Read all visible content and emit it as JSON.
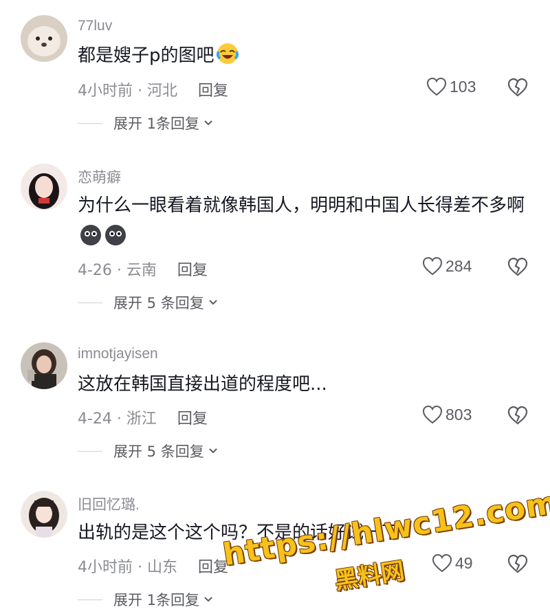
{
  "comments": [
    {
      "username": "77luv",
      "text": "都是嫂子p的图吧",
      "emojis": [
        "laughing-crying-emoji"
      ],
      "time": "4小时前",
      "location": "河北",
      "meta": "4小时前 · 河北",
      "reply_label": "回复",
      "likes": "103",
      "expand_label": "展开 1条回复"
    },
    {
      "username": "恋萌癖",
      "text": "为什么一眼看着就像韩国人，明明和中国人长得差不多啊",
      "emojis": [
        "dark-face-emoji",
        "dark-face-emoji"
      ],
      "meta": "4-26 · 云南",
      "reply_label": "回复",
      "likes": "284",
      "expand_label": "展开 5 条回复"
    },
    {
      "username": "imnotjayisen",
      "text": "这放在韩国直接出道的程度吧...",
      "emojis": [],
      "meta": "4-24 · 浙江",
      "reply_label": "回复",
      "likes": "803",
      "expand_label": "展开 5 条回复"
    },
    {
      "username": "旧回忆璐.",
      "text": "出轨的是这个这个吗？不是的话好试一下",
      "emojis": [],
      "meta": "4小时前 · 山东",
      "reply_label": "回复",
      "likes": "49",
      "expand_label": "展开 1条回复"
    }
  ],
  "watermark": {
    "url": "https://hlwc12.com",
    "brand": "黑料网"
  },
  "colors": {
    "text": "#161823",
    "secondary": "#8a8b91",
    "watermark": "#f6c21b"
  }
}
